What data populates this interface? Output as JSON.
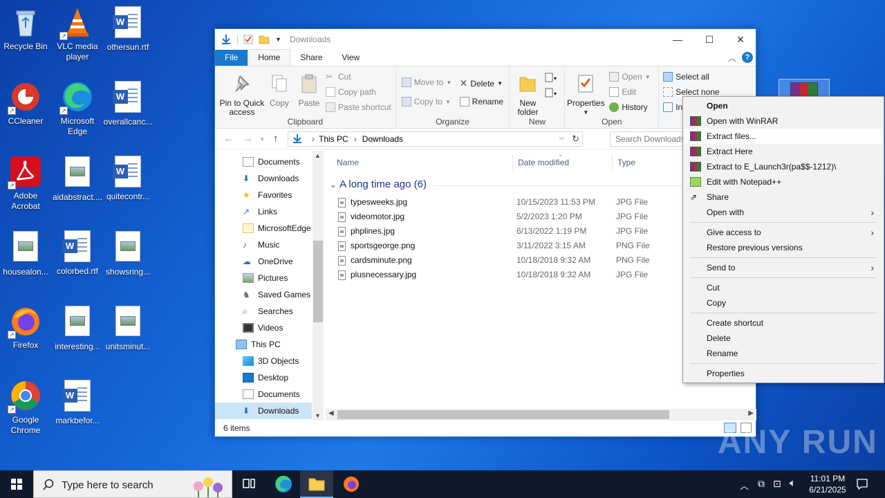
{
  "desktop": {
    "icons": [
      {
        "label": "Recycle Bin"
      },
      {
        "label": "VLC media player"
      },
      {
        "label": "othersun.rtf"
      },
      {
        "label": "CCleaner"
      },
      {
        "label": "Microsoft Edge"
      },
      {
        "label": "overallcanc..."
      },
      {
        "label": "Adobe Acrobat"
      },
      {
        "label": "aidabstract...."
      },
      {
        "label": "quitecontr..."
      },
      {
        "label": "housealon..."
      },
      {
        "label": "colorbed.rtf"
      },
      {
        "label": "showsring..."
      },
      {
        "label": "Firefox"
      },
      {
        "label": "interesting..."
      },
      {
        "label": "unitsminut..."
      },
      {
        "label": "Google Chrome"
      },
      {
        "label": "markbefor..."
      }
    ]
  },
  "window": {
    "title": "Downloads",
    "tabs": {
      "file": "File",
      "home": "Home",
      "share": "Share",
      "view": "View"
    },
    "ribbon": {
      "clipboard": {
        "group": "Clipboard",
        "pin": "Pin to Quick access",
        "copy": "Copy",
        "paste": "Paste",
        "cut": "Cut",
        "copy_path": "Copy path",
        "paste_shortcut": "Paste shortcut"
      },
      "organize": {
        "group": "Organize",
        "move_to": "Move to",
        "copy_to": "Copy to",
        "delete": "Delete",
        "rename": "Rename"
      },
      "new": {
        "group": "New",
        "new_folder": "New folder"
      },
      "open": {
        "group": "Open",
        "properties": "Properties",
        "open": "Open",
        "edit": "Edit",
        "history": "History"
      },
      "select": {
        "select_all": "Select all",
        "select_none": "Select none",
        "invert": "In"
      }
    },
    "address": {
      "path": [
        "This PC",
        "Downloads"
      ]
    },
    "search": {
      "placeholder": "Search Downloads"
    },
    "nav": [
      {
        "label": "Documents",
        "icon": "documents-icon"
      },
      {
        "label": "Downloads",
        "icon": "downloads-icon"
      },
      {
        "label": "Favorites",
        "icon": "favorites-icon"
      },
      {
        "label": "Links",
        "icon": "links-icon"
      },
      {
        "label": "MicrosoftEdge",
        "icon": "folder-icon"
      },
      {
        "label": "Music",
        "icon": "music-icon"
      },
      {
        "label": "OneDrive",
        "icon": "onedrive-icon"
      },
      {
        "label": "Pictures",
        "icon": "pictures-icon"
      },
      {
        "label": "Saved Games",
        "icon": "saved-games-icon"
      },
      {
        "label": "Searches",
        "icon": "searches-icon"
      },
      {
        "label": "Videos",
        "icon": "videos-icon"
      },
      {
        "label": "This PC",
        "icon": "this-pc-icon"
      },
      {
        "label": "3D Objects",
        "icon": "3d-objects-icon"
      },
      {
        "label": "Desktop",
        "icon": "desktop-icon"
      },
      {
        "label": "Documents",
        "icon": "documents-icon"
      },
      {
        "label": "Downloads",
        "icon": "downloads-icon"
      }
    ],
    "columns": {
      "name": "Name",
      "date": "Date modified",
      "type": "Type"
    },
    "group_header": "A long time ago (6)",
    "files": [
      {
        "name": "typesweeks.jpg",
        "date": "10/15/2023 11:53 PM",
        "type": "JPG File"
      },
      {
        "name": "videomotor.jpg",
        "date": "5/2/2023 1:20 PM",
        "type": "JPG File"
      },
      {
        "name": "phplines.jpg",
        "date": "6/13/2022 1:19 PM",
        "type": "JPG File"
      },
      {
        "name": "sportsgeorge.png",
        "date": "3/11/2022 3:15 AM",
        "type": "PNG File"
      },
      {
        "name": "cardsminute.png",
        "date": "10/18/2018 9:32 AM",
        "type": "PNG File"
      },
      {
        "name": "plusnecessary.jpg",
        "date": "10/18/2018 9:32 AM",
        "type": "JPG File"
      }
    ],
    "status": "6 items"
  },
  "context_menu": {
    "items": [
      {
        "label": "Open"
      },
      {
        "label": "Open with WinRAR"
      },
      {
        "label": "Extract files..."
      },
      {
        "label": "Extract Here"
      },
      {
        "label": "Extract to E_Launch3r(pa$$-1212)\\"
      },
      {
        "label": "Edit with Notepad++"
      },
      {
        "label": "Share"
      },
      {
        "label": "Open with"
      },
      {
        "label": "Give access to"
      },
      {
        "label": "Restore previous versions"
      },
      {
        "label": "Send to"
      },
      {
        "label": "Cut"
      },
      {
        "label": "Copy"
      },
      {
        "label": "Create shortcut"
      },
      {
        "label": "Delete"
      },
      {
        "label": "Rename"
      },
      {
        "label": "Properties"
      }
    ]
  },
  "taskbar": {
    "search_placeholder": "Type here to search",
    "time": "11:01 PM",
    "date": "6/21/2025"
  },
  "watermark": "ANY RUN",
  "colors": {
    "accent": "#1979ca",
    "selection": "#cce4f7",
    "desktop": "#1565d8"
  }
}
